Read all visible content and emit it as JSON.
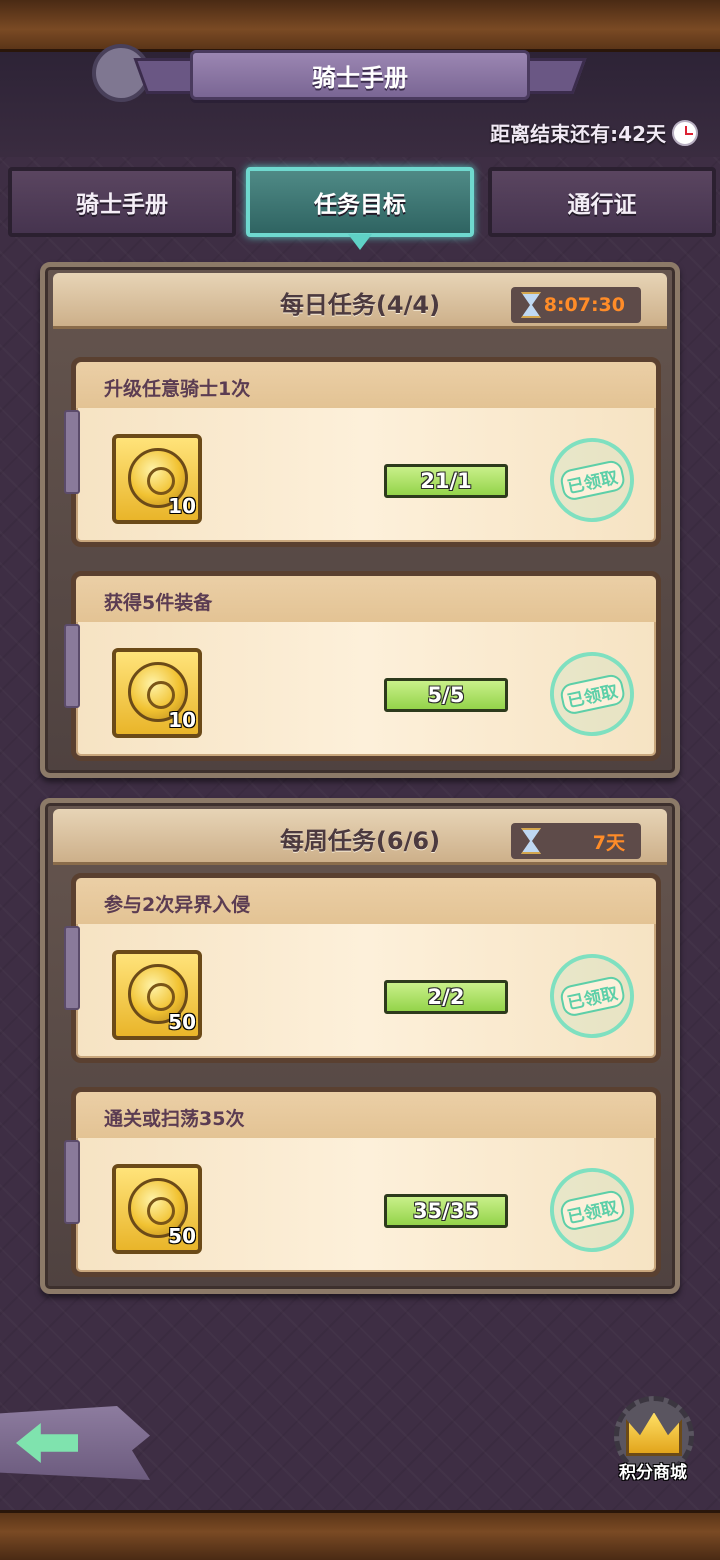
{
  "window": {
    "title": "骑士手册"
  },
  "countdown": {
    "label": "距离结束还有:42天",
    "icon": "clock-icon"
  },
  "tabs": [
    {
      "label": "骑士手册",
      "active": false
    },
    {
      "label": "任务目标",
      "active": true
    },
    {
      "label": "通行证",
      "active": false
    }
  ],
  "daily": {
    "title": "每日任务(4/4)",
    "timer": "8:07:30",
    "tasks": [
      {
        "title": "升级任意骑士1次",
        "reward_qty": "10",
        "progress": "21/1",
        "status": "已领取"
      },
      {
        "title": "获得5件装备",
        "reward_qty": "10",
        "progress": "5/5",
        "status": "已领取"
      }
    ]
  },
  "weekly": {
    "title": "每周任务(6/6)",
    "timer": "7天",
    "tasks": [
      {
        "title": "参与2次异界入侵",
        "reward_qty": "50",
        "progress": "2/2",
        "status": "已领取"
      },
      {
        "title": "通关或扫荡35次",
        "reward_qty": "50",
        "progress": "35/35",
        "status": "已领取"
      }
    ]
  },
  "shop": {
    "label": "积分商城"
  },
  "colors": {
    "active_tab": "#2f6462",
    "progress_fill": "#94d44a",
    "timer_text": "#ff8c28",
    "stamp": "#5dcfa8"
  }
}
